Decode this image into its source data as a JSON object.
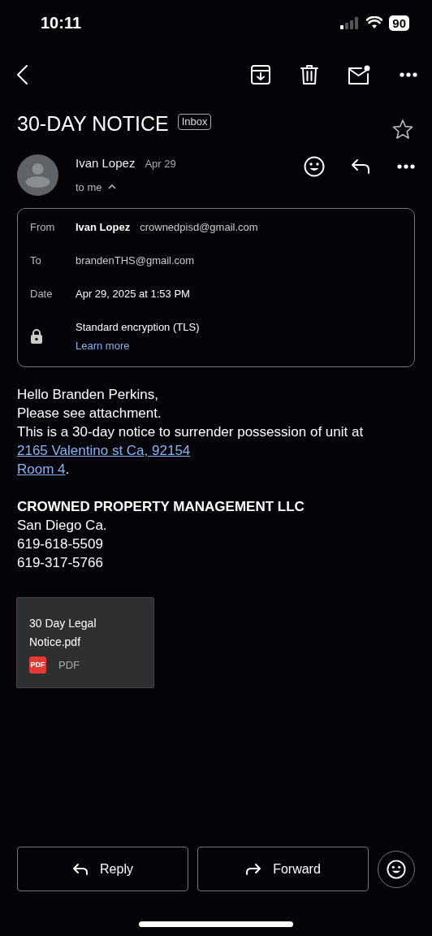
{
  "status_bar": {
    "time": "10:11",
    "battery": "90"
  },
  "subject": {
    "title": "30-DAY NOTICE",
    "label": "Inbox",
    "starred": false
  },
  "sender": {
    "name": "Ivan Lopez",
    "date": "Apr 29",
    "recipient_line": "to me",
    "details_expanded": true
  },
  "details": [
    {
      "kind": "from",
      "label": "From",
      "name": "Ivan Lopez",
      "value": "crownedpisd@gmail.com"
    },
    {
      "kind": "plain",
      "label": "To",
      "value": "brandenTHS@gmail.com"
    },
    {
      "kind": "strong",
      "label": "Date",
      "value": "Apr 29, 2025 at 1:53 PM"
    },
    {
      "kind": "security",
      "value": "Standard encryption (TLS)",
      "link": "Learn more"
    }
  ],
  "body": [
    [
      {
        "text": "Hello Branden Perkins,",
        "link": false
      }
    ],
    [
      {
        "text": "Please see attachment.",
        "link": false
      }
    ],
    [
      {
        "text": "This is a 30-day notice to surrender possession of unit at",
        "link": false
      }
    ],
    [
      {
        "text": "2165 Valentino st Ca, 92154",
        "link": true
      }
    ],
    [
      {
        "text": "Room 4",
        "link": true
      },
      {
        "text": ".",
        "link": false
      }
    ]
  ],
  "signature": {
    "company": "CROWNED PROPERTY MANAGEMENT LLC",
    "lines": [
      "San Diego Ca.",
      "619-618-5509",
      "619-317-5766"
    ]
  },
  "attachment": {
    "name": "30 Day Legal Notice.pdf",
    "icon_text": "PDF",
    "type": "PDF"
  },
  "actions": [
    "Reply",
    "Forward"
  ]
}
